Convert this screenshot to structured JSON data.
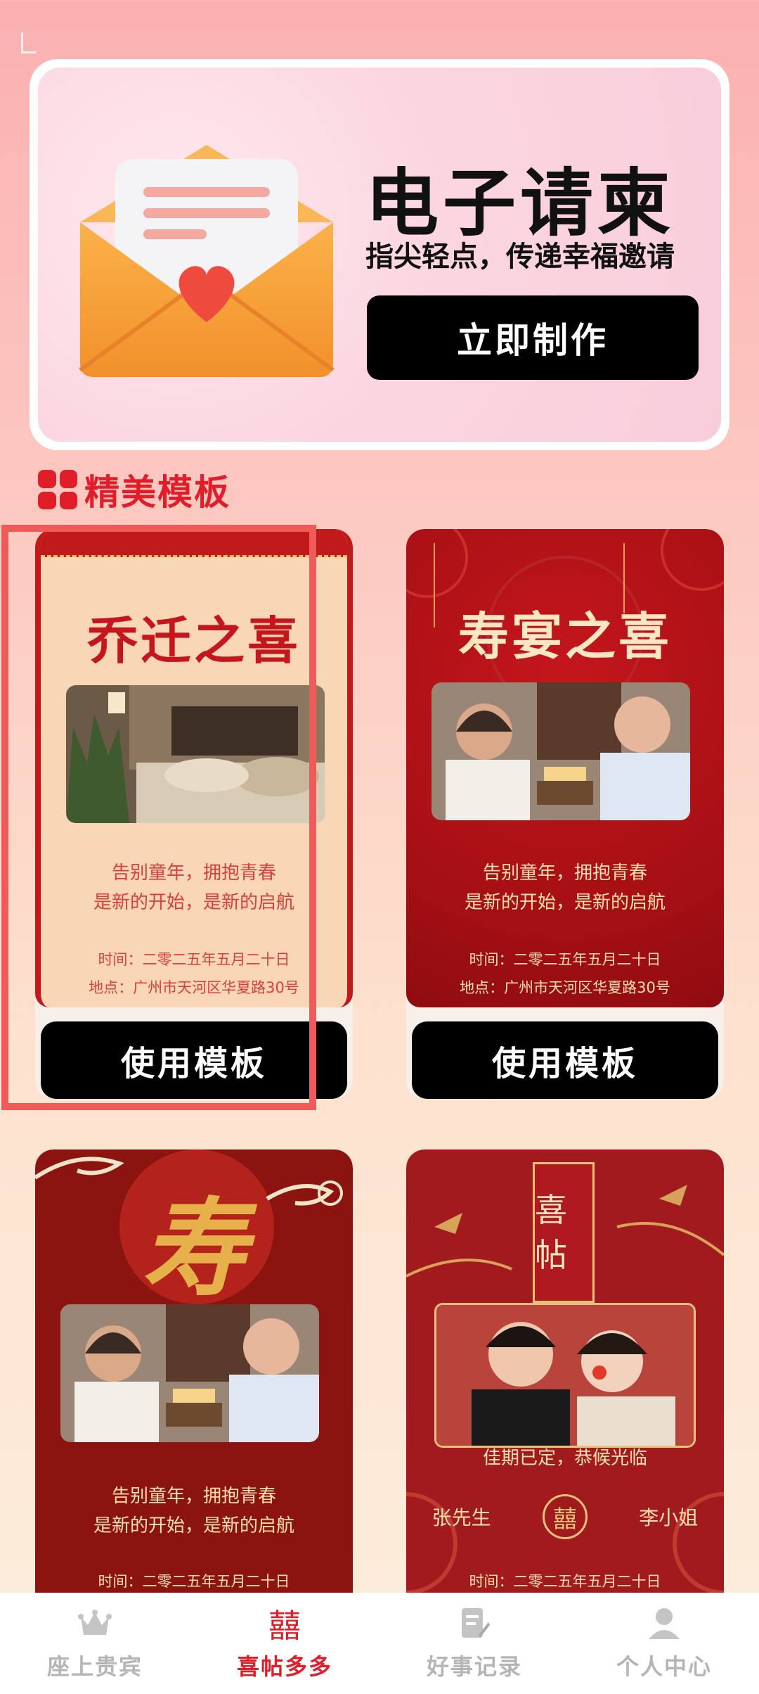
{
  "banner": {
    "title": "电子请柬",
    "subtitle": "指尖轻点，传递幸福邀请",
    "button_label": "立即制作"
  },
  "section": {
    "title": "精美模板"
  },
  "templates": [
    {
      "title": "乔迁之喜",
      "line1": "告别童年，拥抱青春",
      "line2": "是新的开始，是新的启航",
      "time": "时间：二零二五年五月二十日",
      "place": "地点：广州市天河区华夏路30号",
      "button_label": "使用模板"
    },
    {
      "title": "寿宴之喜",
      "line1": "告别童年，拥抱青春",
      "line2": "是新的开始，是新的启航",
      "time": "时间：二零二五年五月二十日",
      "place": "地点：广州市天河区华夏路30号",
      "button_label": "使用模板"
    },
    {
      "title": "寿",
      "line1": "告别童年，拥抱青春",
      "line2": "是新的开始，是新的启航",
      "time": "时间：二零二五年五月二十日"
    },
    {
      "title": "喜帖",
      "greeting": "佳期已定，恭候光临",
      "groom": "张先生",
      "bride": "李小姐",
      "emblem": "囍",
      "time": "时间：二零二五年五月二十日"
    }
  ],
  "tabbar": [
    {
      "label": "座上贵宾",
      "icon": "crown-icon",
      "active": false
    },
    {
      "label": "喜帖多多",
      "icon": "double-happiness-icon",
      "glyph": "囍",
      "active": true
    },
    {
      "label": "好事记录",
      "icon": "note-edit-icon",
      "active": false
    },
    {
      "label": "个人中心",
      "icon": "user-icon",
      "active": false
    }
  ],
  "colors": {
    "accent": "#e11d2a",
    "inactive_tab": "#b5b5b5",
    "highlight": "#ef5a5a"
  }
}
